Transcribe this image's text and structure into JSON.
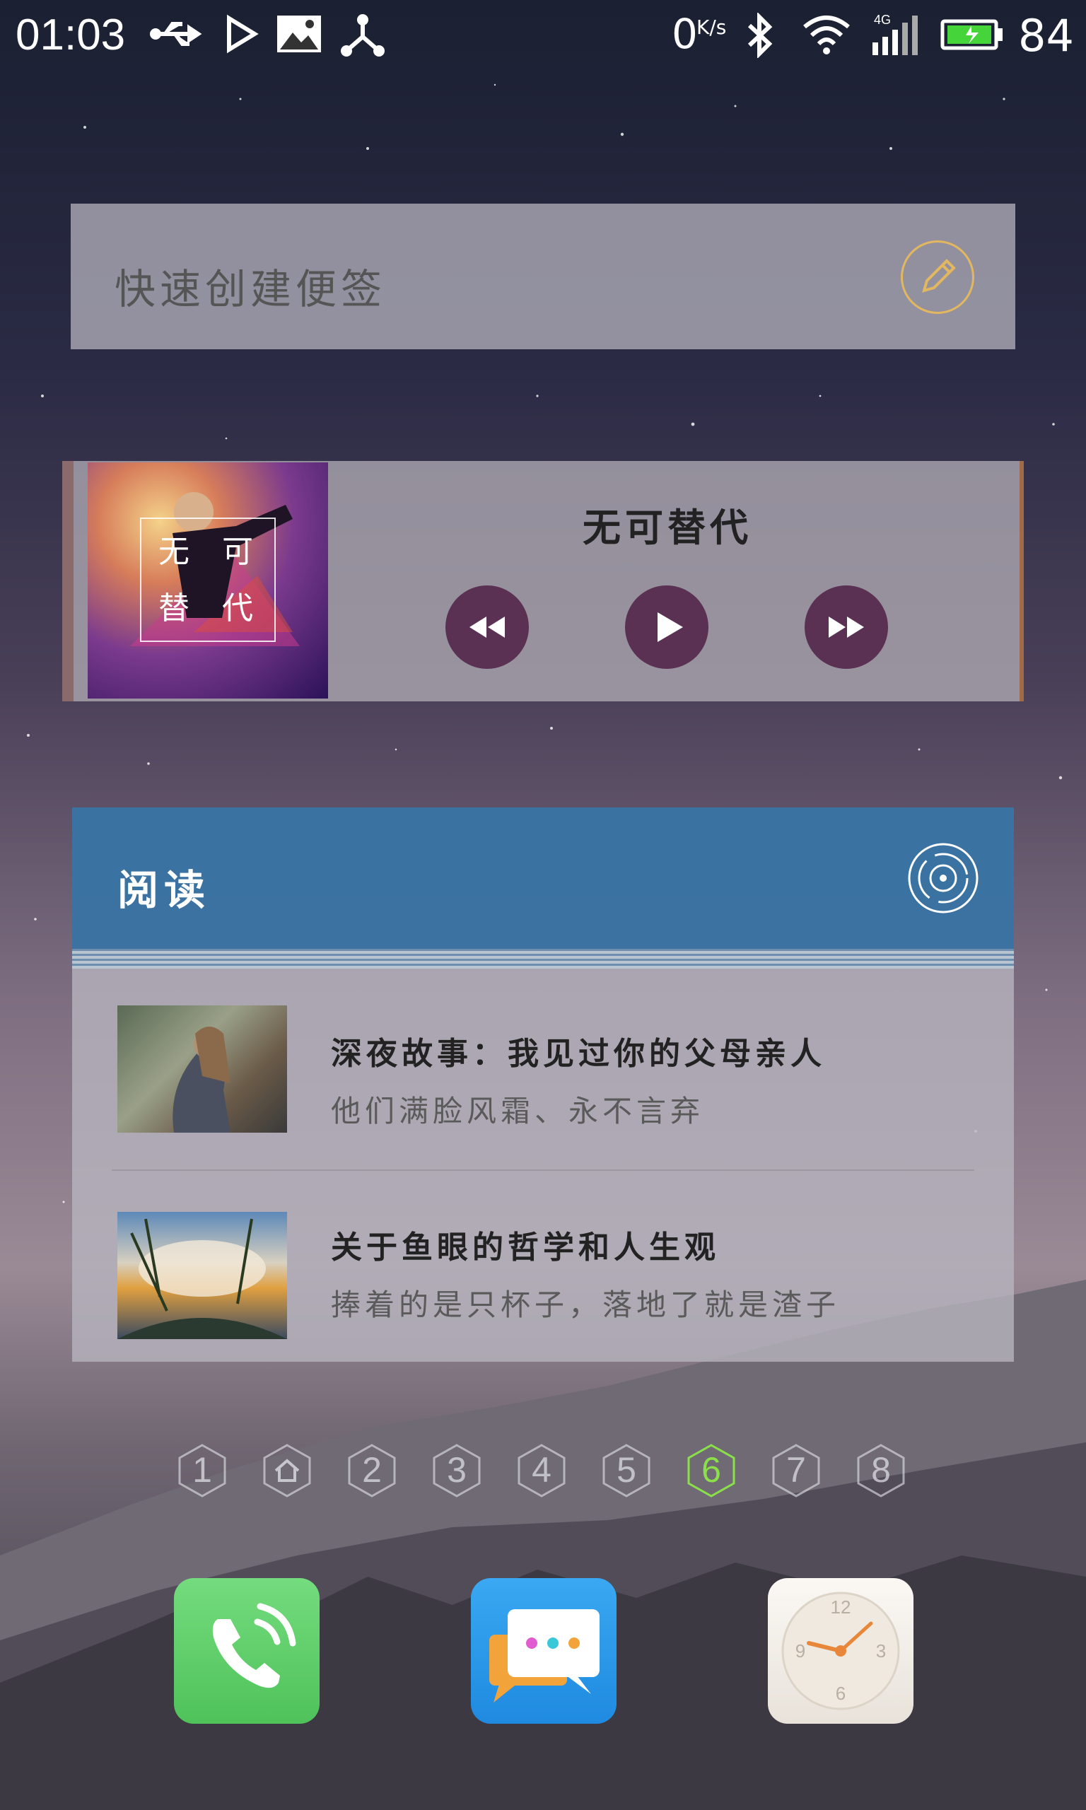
{
  "status_bar": {
    "time": "01:03",
    "net_speed": "0",
    "net_speed_unit": "K/s",
    "network": "4G",
    "battery_percent": "84",
    "icons": [
      "usb-icon",
      "play-store-icon",
      "image-icon",
      "share-icon",
      "bluetooth-icon",
      "wifi-icon",
      "signal-icon",
      "battery-icon"
    ]
  },
  "quick_note": {
    "label": "快速创建便签",
    "icon": "pencil-icon"
  },
  "music": {
    "song_title": "无可替代",
    "album_text": [
      "无",
      "可",
      "替",
      "代"
    ],
    "controls": [
      "previous-icon",
      "play-icon",
      "next-icon"
    ],
    "accent_color": "#5a3152"
  },
  "reading": {
    "title": "阅读",
    "header_color": "#2f6da0",
    "articles": [
      {
        "title": "深夜故事：我见过你的父母亲人",
        "subtitle": "他们满脸风霜、永不言弃"
      },
      {
        "title": "关于鱼眼的哲学和人生观",
        "subtitle": "捧着的是只杯子，落地了就是渣子"
      }
    ]
  },
  "pages": {
    "items": [
      "1",
      "home",
      "2",
      "3",
      "4",
      "5",
      "6",
      "7",
      "8"
    ],
    "active": "6",
    "active_color": "#8be04a"
  },
  "dock": {
    "apps": [
      {
        "name": "phone",
        "color": "#5fd16a"
      },
      {
        "name": "messages",
        "color": "#2e9cf0"
      },
      {
        "name": "clock",
        "color": "#f0ece6",
        "numbers": [
          "12",
          "3",
          "6",
          "9"
        ]
      }
    ]
  }
}
